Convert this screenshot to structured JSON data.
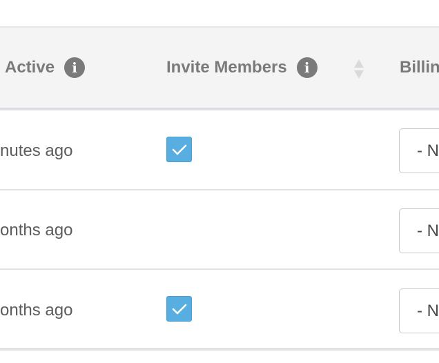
{
  "table": {
    "headers": {
      "active": "Active",
      "invite_members": "Invite Members",
      "billing": "Billin"
    },
    "info_icon_glyph": "i",
    "rows": [
      {
        "last_active": "nutes ago",
        "invite_members_checked": true,
        "billing_value": "- N"
      },
      {
        "last_active": "onths ago",
        "invite_members_checked": false,
        "billing_value": "- N"
      },
      {
        "last_active": "onths ago",
        "invite_members_checked": true,
        "billing_value": "- N"
      }
    ]
  },
  "colors": {
    "checkbox": "#58aee0",
    "header_bg": "#f4f4f4",
    "header_text": "#7a7a7a"
  },
  "icons": {
    "info": "info-icon",
    "sort": "sort-icon",
    "check": "checkmark-icon"
  }
}
